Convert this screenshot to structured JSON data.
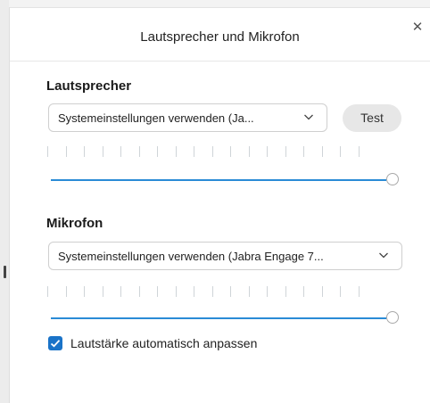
{
  "dialog": {
    "title": "Lautsprecher und Mikrofon",
    "close_icon": "close-icon"
  },
  "speaker": {
    "section_title": "Lautsprecher",
    "device": "Systemeinstellungen verwenden (Ja...",
    "test_label": "Test",
    "volume": 1.0
  },
  "microphone": {
    "section_title": "Mikrofon",
    "device": "Systemeinstellungen verwenden (Jabra Engage 7...",
    "volume": 1.0
  },
  "auto_adjust": {
    "label": "Lautstärke automatisch anpassen",
    "checked": true
  },
  "colors": {
    "accent": "#1a73c8",
    "slider_track": "#2a8bd6"
  }
}
